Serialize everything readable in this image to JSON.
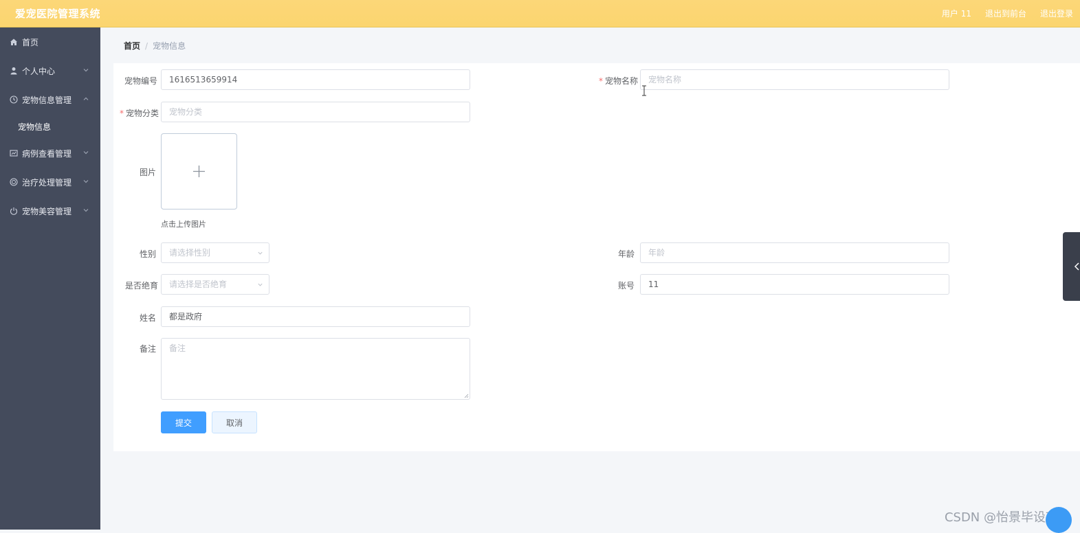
{
  "header": {
    "app_title": "爱宠医院管理系统",
    "user": "用户 11",
    "goto_front": "退出到前台",
    "logout": "退出登录"
  },
  "sidebar": {
    "items": [
      {
        "label": "首页",
        "icon": "home-icon"
      },
      {
        "label": "个人中心",
        "icon": "user-icon",
        "expanded": false
      },
      {
        "label": "宠物信息管理",
        "icon": "clock-icon",
        "expanded": true
      },
      {
        "label": "病例查看管理",
        "icon": "chart-icon",
        "expanded": false
      },
      {
        "label": "治疗处理管理",
        "icon": "target-icon",
        "expanded": false
      },
      {
        "label": "宠物美容管理",
        "icon": "power-icon",
        "expanded": false
      }
    ],
    "submenu": {
      "label": "宠物信息"
    }
  },
  "breadcrumb": {
    "home": "首页",
    "separator": "/",
    "current": "宠物信息"
  },
  "form": {
    "pet_id": {
      "label": "宠物编号",
      "value": "1616513659914"
    },
    "pet_name": {
      "label": "宠物名称",
      "placeholder": "宠物名称"
    },
    "category": {
      "label": "宠物分类",
      "placeholder": "宠物分类"
    },
    "image": {
      "label": "图片",
      "hint": "点击上传图片"
    },
    "gender": {
      "label": "性别",
      "placeholder": "请选择性别"
    },
    "age": {
      "label": "年龄",
      "placeholder": "年龄"
    },
    "neutered": {
      "label": "是否绝育",
      "placeholder": "请选择是否绝育"
    },
    "account": {
      "label": "账号",
      "value": "11"
    },
    "name": {
      "label": "姓名",
      "value": "都是政府"
    },
    "remark": {
      "label": "备注",
      "placeholder": "备注"
    },
    "submit": "提交",
    "cancel": "取消"
  },
  "watermark": "CSDN @怡景毕设项目",
  "colors": {
    "topbar": "#fbd56f",
    "sidebar": "#444b5c",
    "primary": "#409eff",
    "required": "#f56c6c"
  }
}
